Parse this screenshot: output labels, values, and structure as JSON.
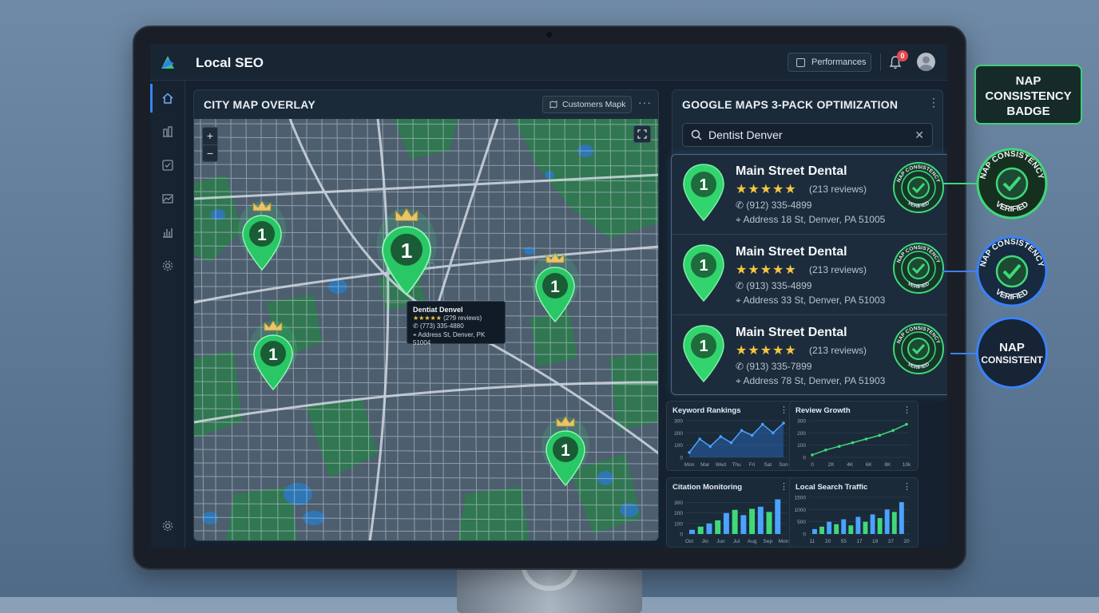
{
  "app": {
    "title": "Local SEO"
  },
  "header": {
    "performance_label": "Performances",
    "notification_count": "0"
  },
  "sidebar": {
    "items": [
      "home-icon",
      "buildings-icon",
      "checklist-icon",
      "trend-icon",
      "bar-chart-icon",
      "settings-icon"
    ],
    "bottom": "settings-icon"
  },
  "map_panel": {
    "title": "CITY MAP OVERLAY",
    "filter_label": "Customers Mapk",
    "zoom_in": "+",
    "zoom_out": "−",
    "pins": [
      {
        "rank": "1",
        "crown": true
      },
      {
        "rank": "1",
        "crown": true
      },
      {
        "rank": "1",
        "crown": true
      },
      {
        "rank": "1",
        "crown": true
      },
      {
        "rank": "1",
        "crown": true
      }
    ],
    "tooltip": {
      "name": "Dentiat Denvel",
      "stars": "★★★★★",
      "reviews": "(2?9 reviews)",
      "phone": "(773) 335-4880",
      "address": "Address St, Denver, PK 51004"
    }
  },
  "pack_panel": {
    "title": "GOOGLE MAPS 3-PACK OPTIMIZATION",
    "search_value": "Dentist Denver",
    "listings": [
      {
        "rank": "1",
        "name": "Main Street Dental",
        "stars": "★★★★★",
        "reviews": "(213 reviews)",
        "phone": "(912) 335-4899",
        "address": "Address 18 St, Denver, PA 51005",
        "badge_top": "NAP CONSISTENCY",
        "badge_bottom": "VERIFIED"
      },
      {
        "rank": "1",
        "name": "Main Street Dental",
        "stars": "★★★★★",
        "reviews": "(213 reviews)",
        "phone": "(913) 335-4899",
        "address": "Address 33 St, Denver, PA 51003",
        "badge_top": "NAP CONSISTENCY",
        "badge_bottom": "VERIFIED"
      },
      {
        "rank": "1",
        "name": "Main Street Dental",
        "stars": "★★★★★",
        "reviews": "(213 reviews)",
        "phone": "(913) 335-7899",
        "address": "Address 78 St, Denver, PA 51903",
        "badge_top": "NAP CONSISTENCY",
        "badge_bottom": "VERIFIED"
      }
    ]
  },
  "widgets": {
    "keyword_rankings": {
      "title": "Keyword Rankings"
    },
    "review_growth": {
      "title": "Review Growth"
    },
    "citation_monitoring": {
      "title": "Citation Monitoring"
    },
    "local_search_traffic": {
      "title": "Local Search Traffic"
    }
  },
  "chart_data": [
    {
      "type": "line",
      "title": "Keyword Rankings",
      "x": [
        "Mon",
        "Mar",
        "Wed",
        "Thu",
        "Fri",
        "Sat",
        "Son"
      ],
      "y_ticks": [
        "0",
        "100",
        "200",
        "300"
      ],
      "values": [
        40,
        150,
        90,
        170,
        120,
        220,
        180,
        270,
        200,
        280
      ],
      "ylim": [
        0,
        300
      ],
      "area": true
    },
    {
      "type": "line",
      "title": "Review Growth",
      "x": [
        "0",
        "2K",
        "4K",
        "6K",
        "8K",
        "10k"
      ],
      "y_ticks": [
        "0",
        "100",
        "200",
        "300"
      ],
      "values": [
        20,
        60,
        90,
        120,
        150,
        180,
        220,
        270
      ],
      "ylim": [
        0,
        300
      ]
    },
    {
      "type": "bar",
      "title": "Citation Monitoring",
      "categories": [
        "Oct",
        "Jlo",
        "Jun",
        "Jul",
        "Aug",
        "Sep",
        "Mon"
      ],
      "y_ticks": [
        "0",
        "100",
        "200",
        "300"
      ],
      "values": [
        40,
        70,
        100,
        130,
        200,
        230,
        180,
        240,
        260,
        210,
        330
      ],
      "ylim": [
        0,
        350
      ]
    },
    {
      "type": "bar",
      "title": "Local Search Traffic",
      "categories": [
        "11",
        "20",
        "55",
        "17",
        "19",
        "37",
        "20"
      ],
      "y_ticks": [
        "0",
        "500",
        "1000",
        "1500"
      ],
      "values": [
        200,
        300,
        500,
        400,
        600,
        350,
        700,
        500,
        800,
        650,
        1000,
        900,
        1300
      ],
      "ylim": [
        0,
        1500
      ]
    }
  ],
  "callouts": {
    "box": "NAP CONSISTENCY BADGE",
    "badge1_top": "NAP CONSISTENCY",
    "badge1_bottom": "VERIFIED",
    "badge2_top": "NAP CONSISTENCY",
    "badge2_bottom": "VERIFIED",
    "badge3_line1": "NAP",
    "badge3_line2": "CONSISTENT"
  },
  "colors": {
    "accent_green": "#3fd97a",
    "accent_blue": "#3b82f6",
    "star": "#f5c542",
    "panel": "#1b2a39"
  }
}
